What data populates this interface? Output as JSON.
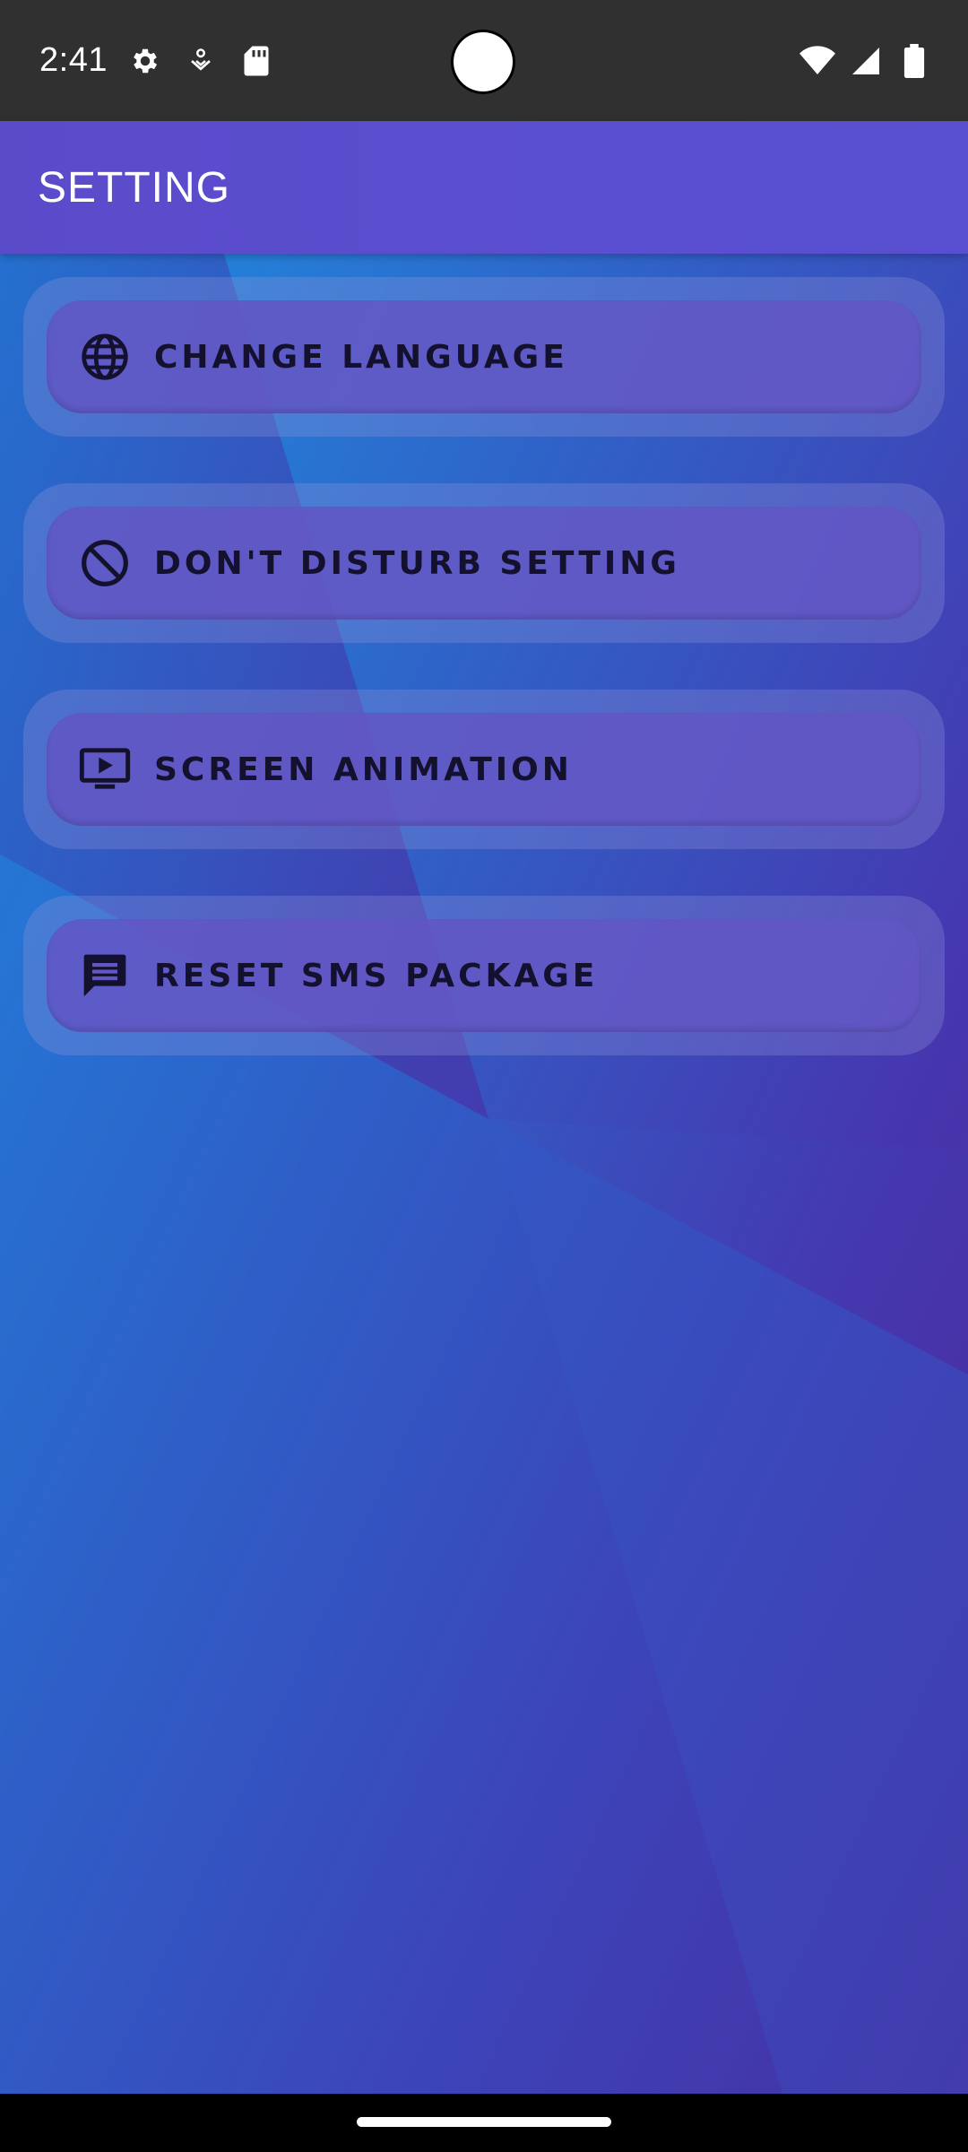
{
  "status_bar": {
    "time": "2:41",
    "left_icons": [
      "settings-gear-icon",
      "hands-badge-icon",
      "sd-card-icon"
    ],
    "right_icons": [
      "wifi-icon",
      "signal-icon",
      "battery-icon"
    ]
  },
  "app_bar": {
    "title": "SETTING"
  },
  "menu": {
    "items": [
      {
        "label": "CHANGE LANGUAGE",
        "icon": "globe-icon"
      },
      {
        "label": "DON'T DISTURB SETTING",
        "icon": "block-icon"
      },
      {
        "label": "SCREEN ANIMATION",
        "icon": "screen-play-icon"
      },
      {
        "label": "RESET SMS PACKAGE",
        "icon": "message-icon"
      }
    ]
  },
  "colors": {
    "status_bar_bg": "#303030",
    "app_bar_bg": "#5a4fd0",
    "gradient_start": "#1e8fe0",
    "gradient_end": "#521f94",
    "label_text": "#14112e"
  }
}
